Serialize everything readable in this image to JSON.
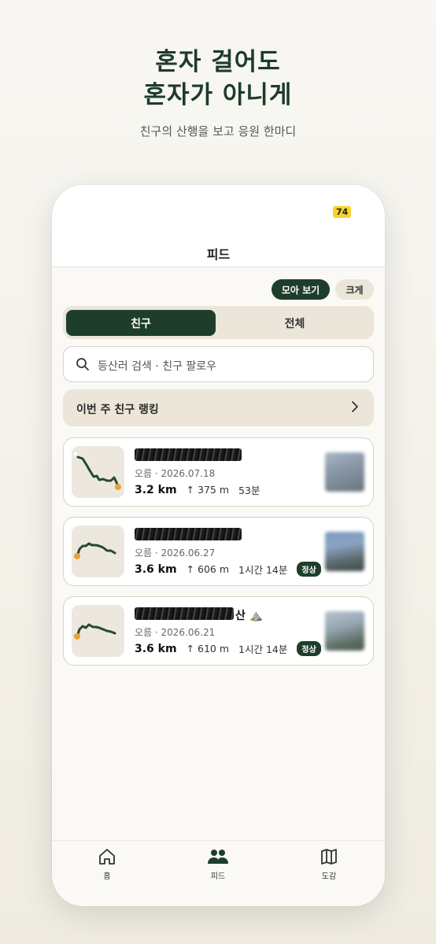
{
  "hero": {
    "title_line1": "혼자 걸어도",
    "title_line2": "혼자가 아니게",
    "subtitle": "친구의 산행을 보고 응원 한마디"
  },
  "status": {
    "battery": "74"
  },
  "header": {
    "title": "피드"
  },
  "view_toggle": {
    "collect": "모아 보기",
    "large": "크게",
    "selected": "모아 보기"
  },
  "tabs_segment": {
    "friends": "친구",
    "all": "전체",
    "selected": "친구"
  },
  "search": {
    "placeholder": "등산러 검색 · 친구 팔로우"
  },
  "ranking": {
    "label": "이번 주 친구 랭킹"
  },
  "cards": [
    {
      "name_visible": "",
      "sub": "오름 · 2026.07.18",
      "distance": "3.2 km",
      "elevation": "↑ 375 m",
      "duration": "53분",
      "badge": ""
    },
    {
      "name_visible": "",
      "sub": "오름 · 2026.06.27",
      "distance": "3.6 km",
      "elevation": "↑ 606 m",
      "duration": "1시간 14분",
      "badge": "정상"
    },
    {
      "name_visible": "산 ⛰️",
      "sub": "오름 · 2026.06.21",
      "distance": "3.6 km",
      "elevation": "↑ 610 m",
      "duration": "1시간 14분",
      "badge": "정상"
    }
  ],
  "bottom_nav": [
    {
      "label": "홈",
      "icon": "home-icon"
    },
    {
      "label": "피드",
      "icon": "people-icon"
    },
    {
      "label": "도감",
      "icon": "map-icon"
    }
  ],
  "colors": {
    "primary": "#1e3e2b",
    "surface": "#ebe6d9",
    "route": "#234a32",
    "marker": "#e7a33b",
    "battery": "#f8d32b"
  }
}
